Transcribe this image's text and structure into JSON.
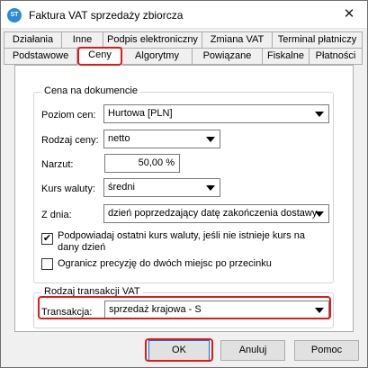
{
  "window": {
    "title": "Faktura VAT sprzedaży zbiorcza",
    "icon_text": "ST",
    "close_symbol": "✕"
  },
  "tabs_row1": [
    "Działania",
    "Inne",
    "Podpis elektroniczny",
    "Zmiana VAT",
    "Terminal płatniczy"
  ],
  "tabs_row2": [
    "Podstawowe",
    "Ceny",
    "Algorytmy",
    "Powiązane",
    "Fiskalne",
    "Płatności"
  ],
  "active_tab": "Ceny",
  "price_group": {
    "title": "Cena na dokumencie",
    "price_level_label": "Poziom cen:",
    "price_level_value": "Hurtowa [PLN]",
    "price_type_label": "Rodzaj ceny:",
    "price_type_value": "netto",
    "markup_label": "Narzut:",
    "markup_value": "50,00 %",
    "rate_label": "Kurs waluty:",
    "rate_value": "średni",
    "from_day_label": "Z dnia:",
    "from_day_value": "dzień poprzedzający datę zakończenia dostawy",
    "suggest_rate_line1": "Podpowiadaj ostatni kurs waluty, jeśli nie istnieje kurs na",
    "suggest_rate_line2": "dany dzień",
    "suggest_rate_checked": true,
    "limit_precision": "Ogranicz precyzję do dwóch miejsc po przecinku",
    "limit_precision_checked": false
  },
  "vat_group": {
    "title": "Rodzaj transakcji VAT",
    "transaction_label": "Transakcja:",
    "transaction_value": "sprzedaż krajowa - S"
  },
  "buttons": {
    "ok": "OK",
    "cancel": "Anuluj",
    "help": "Pomoc"
  },
  "colors": {
    "highlight": "#e01a1a",
    "app_icon": "#2a8bd6"
  }
}
